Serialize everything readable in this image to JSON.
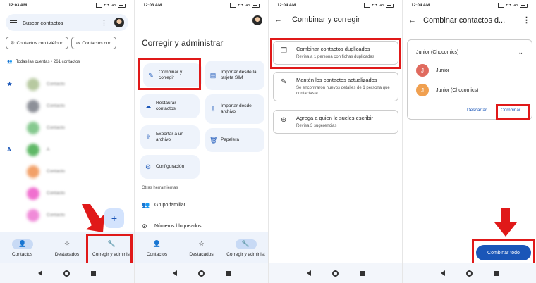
{
  "status": {
    "time1": "12:03 AM",
    "time2": "12:03 AM",
    "time3": "12:04 AM",
    "time4": "12:04 AM",
    "battery": "48"
  },
  "panel1": {
    "search_placeholder": "Buscar contactos",
    "chip_phone": "Contactos con teléfono",
    "chip_email": "Contactos con",
    "accounts_text": "Todas las cuentas • 261 contactos",
    "section_letter": "A",
    "contacts": [
      {
        "name": "Contacto",
        "color": "#b7c9a0"
      },
      {
        "name": "Contacto",
        "color": "#8d9098"
      },
      {
        "name": "Contacto",
        "color": "#86c98f"
      },
      {
        "name": "A",
        "color": "#5fb866"
      },
      {
        "name": "Contacto",
        "color": "#f2a068"
      },
      {
        "name": "Contacto",
        "color": "#f06fcf"
      },
      {
        "name": "Contacto",
        "color": "#f08ad8"
      },
      {
        "name": "Contacto",
        "color": "#f2a068"
      }
    ],
    "tabs": [
      {
        "label": "Contactos",
        "icon": "👤"
      },
      {
        "label": "Destacados",
        "icon": "☆"
      },
      {
        "label": "Corregir y administ",
        "icon": "🔧"
      }
    ]
  },
  "panel2": {
    "title": "Corregir y administrar",
    "tools": [
      {
        "label": "Combinar y corregir",
        "icon": "✎"
      },
      {
        "label": "Importar desde la tarjeta SIM",
        "icon": "▤"
      },
      {
        "label": "Restaurar contactos",
        "icon": "☁"
      },
      {
        "label": "Importar desde archivo",
        "icon": "⇩"
      },
      {
        "label": "Exportar a un archivo",
        "icon": "⇧"
      },
      {
        "label": "Papelera",
        "icon": "🗑"
      },
      {
        "label": "Configuración",
        "icon": "⚙"
      }
    ],
    "other_title": "Otras herramientas",
    "other": [
      {
        "label": "Grupo familiar",
        "icon": "👥"
      },
      {
        "label": "Números bloqueados",
        "icon": "⊘"
      }
    ],
    "tabs": [
      {
        "label": "Contactos"
      },
      {
        "label": "Destacados"
      },
      {
        "label": "Corregir y administ"
      }
    ]
  },
  "panel3": {
    "title": "Combinar y corregir",
    "cards": [
      {
        "title": "Combinar contactos duplicados",
        "subtitle": "Revisa a 1 persona con fichas duplicadas",
        "icon": "❐"
      },
      {
        "title": "Mantén los contactos actualizados",
        "subtitle": "Se encontraron nuevos detalles de 1 persona que contactaste",
        "icon": "✎"
      },
      {
        "title": "Agrega a quien le sueles escribir",
        "subtitle": "Revisa 3 sugerencias",
        "icon": "⊕"
      }
    ]
  },
  "panel4": {
    "title": "Combinar contactos d...",
    "group_title": "Junior (Chocomics)",
    "rows": [
      {
        "name": "Junior",
        "initial": "J",
        "color": "#e06a5e"
      },
      {
        "name": "Junior (Chocomics)",
        "initial": "J",
        "color": "#f0a050"
      }
    ],
    "discard": "Descartar",
    "combine": "Combinar",
    "combine_all": "Combinar todo"
  }
}
